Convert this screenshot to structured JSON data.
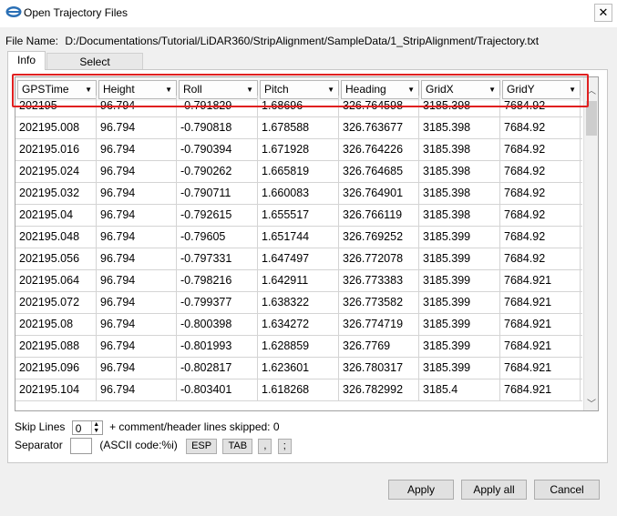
{
  "window": {
    "title": "Open Trajectory Files",
    "close_symbol": "✕"
  },
  "file": {
    "label": "File Name:",
    "value": "D:/Documentations/Tutorial/LiDAR360/StripAlignment/SampleData/1_StripAlignment/Trajectory.txt"
  },
  "tabs": [
    {
      "label": "Info"
    },
    {
      "label": "Select Coordinate"
    }
  ],
  "table": {
    "columns": [
      "GPSTime",
      "Height",
      "Roll",
      "Pitch",
      "Heading",
      "GridX",
      "GridY"
    ],
    "rows": [
      [
        "202195",
        "96.794",
        "-0.791829",
        "1.68696",
        "326.764598",
        "3185.398",
        "7684.92"
      ],
      [
        "202195.008",
        "96.794",
        "-0.790818",
        "1.678588",
        "326.763677",
        "3185.398",
        "7684.92"
      ],
      [
        "202195.016",
        "96.794",
        "-0.790394",
        "1.671928",
        "326.764226",
        "3185.398",
        "7684.92"
      ],
      [
        "202195.024",
        "96.794",
        "-0.790262",
        "1.665819",
        "326.764685",
        "3185.398",
        "7684.92"
      ],
      [
        "202195.032",
        "96.794",
        "-0.790711",
        "1.660083",
        "326.764901",
        "3185.398",
        "7684.92"
      ],
      [
        "202195.04",
        "96.794",
        "-0.792615",
        "1.655517",
        "326.766119",
        "3185.398",
        "7684.92"
      ],
      [
        "202195.048",
        "96.794",
        "-0.79605",
        "1.651744",
        "326.769252",
        "3185.399",
        "7684.92"
      ],
      [
        "202195.056",
        "96.794",
        "-0.797331",
        "1.647497",
        "326.772078",
        "3185.399",
        "7684.92"
      ],
      [
        "202195.064",
        "96.794",
        "-0.798216",
        "1.642911",
        "326.773383",
        "3185.399",
        "7684.921"
      ],
      [
        "202195.072",
        "96.794",
        "-0.799377",
        "1.638322",
        "326.773582",
        "3185.399",
        "7684.921"
      ],
      [
        "202195.08",
        "96.794",
        "-0.800398",
        "1.634272",
        "326.774719",
        "3185.399",
        "7684.921"
      ],
      [
        "202195.088",
        "96.794",
        "-0.801993",
        "1.628859",
        "326.7769",
        "3185.399",
        "7684.921"
      ],
      [
        "202195.096",
        "96.794",
        "-0.802817",
        "1.623601",
        "326.780317",
        "3185.399",
        "7684.921"
      ],
      [
        "202195.104",
        "96.794",
        "-0.803401",
        "1.618268",
        "326.782992",
        "3185.4",
        "7684.921"
      ]
    ]
  },
  "skip": {
    "label": "Skip Lines",
    "value": "0",
    "suffix": "+ comment/header lines skipped: 0"
  },
  "separator": {
    "label": "Separator",
    "ascii_label": "(ASCII code:%i)",
    "buttons": [
      "ESP",
      "TAB",
      ",",
      ";"
    ]
  },
  "actions": {
    "apply": "Apply",
    "apply_all": "Apply all",
    "cancel": "Cancel"
  },
  "colors": {
    "highlight": "#e02020"
  }
}
